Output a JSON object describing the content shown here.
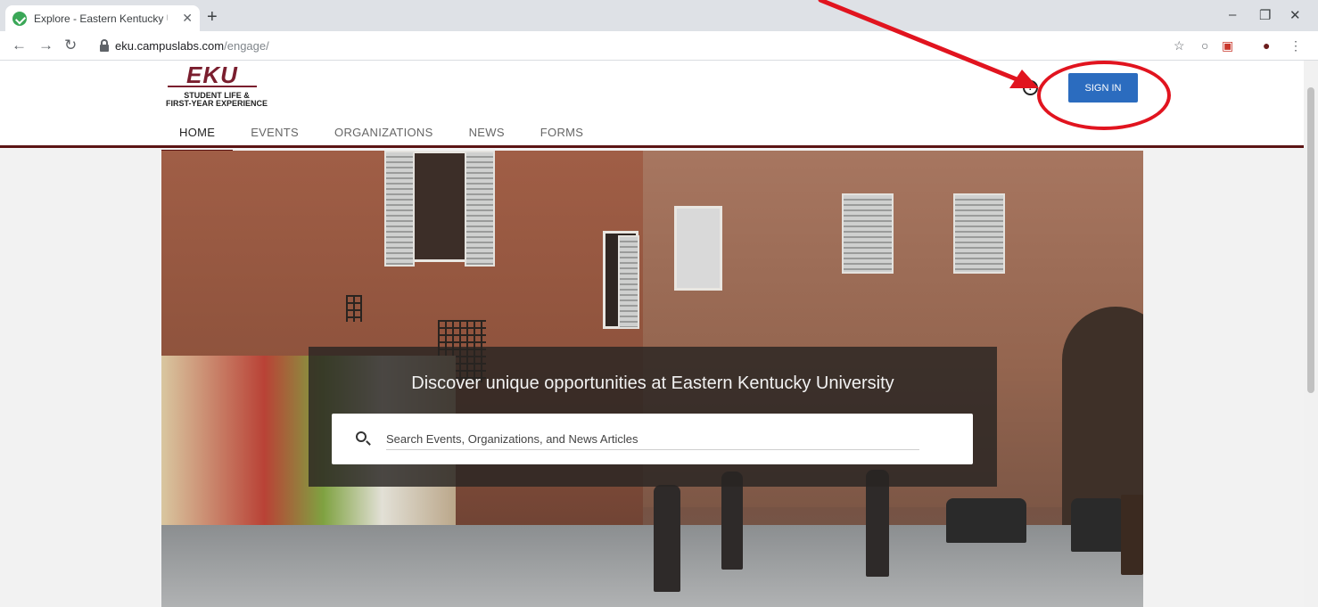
{
  "browser": {
    "tab_title": "Explore - Eastern Kentucky Unive",
    "tab_close": "✕",
    "new_tab": "+",
    "url_host": "eku.campuslabs.com",
    "url_path": "/engage/",
    "win_min": "–",
    "win_restore": "❐",
    "win_close": "✕"
  },
  "header": {
    "logo_text": "EKU",
    "logo_line1": "STUDENT LIFE &",
    "logo_line2": "FIRST-YEAR EXPERIENCE",
    "help": "?",
    "signin_label": "SIGN IN"
  },
  "nav": {
    "items": [
      {
        "label": "HOME",
        "active": true
      },
      {
        "label": "EVENTS",
        "active": false
      },
      {
        "label": "ORGANIZATIONS",
        "active": false
      },
      {
        "label": "NEWS",
        "active": false
      },
      {
        "label": "FORMS",
        "active": false
      }
    ]
  },
  "hero": {
    "title": "Discover unique opportunities at Eastern Kentucky University",
    "search_placeholder": "Search Events, Organizations, and News Articles"
  },
  "annotation": {
    "color": "#e1141f"
  }
}
